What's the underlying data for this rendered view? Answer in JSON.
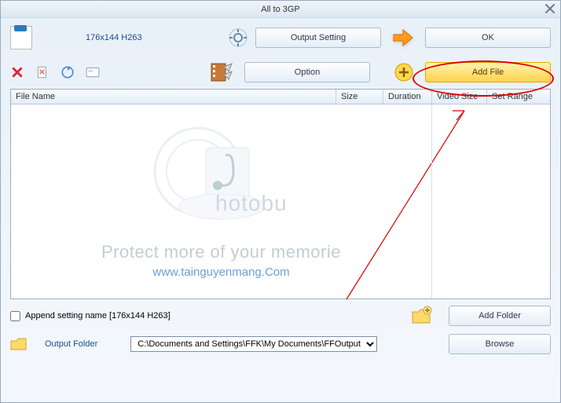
{
  "window": {
    "title": "All to 3GP"
  },
  "format": {
    "label": "176x144 H263"
  },
  "buttons": {
    "output_setting": "Output Setting",
    "ok": "OK",
    "option": "Option",
    "add_file": "Add File",
    "add_folder": "Add Folder",
    "browse": "Browse"
  },
  "grid": {
    "headers": {
      "file_name": "File Name",
      "size": "Size",
      "duration": "Duration",
      "video_size": "Video Size",
      "set_range": "Set Range"
    }
  },
  "watermark": {
    "photobucket": "hotobu",
    "line1": "Protect more of your memorie",
    "line2": "www.tainguyenmang.Com"
  },
  "footer": {
    "append_label": "Append setting name [176x144 H263]",
    "output_folder_label": "Output Folder",
    "output_path": "C:\\Documents and Settings\\FFK\\My Documents\\FFOutput"
  }
}
